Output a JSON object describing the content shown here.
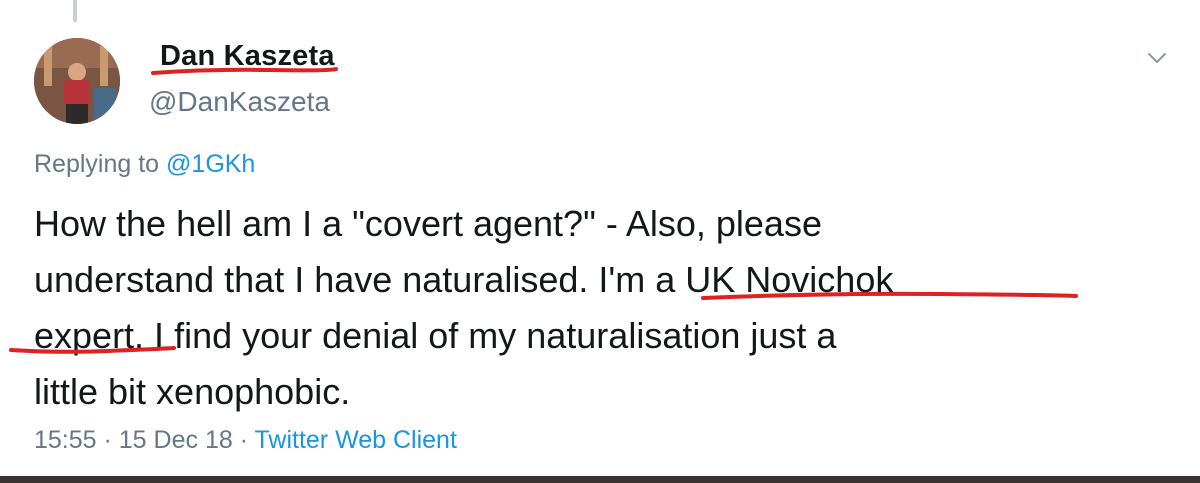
{
  "tweet": {
    "display_name": "Dan Kaszeta",
    "handle": "@DanKaszeta",
    "replying_prefix": "Replying to ",
    "replying_to": "@1GKh",
    "text_lines": [
      "How the hell am I a \"covert agent?\" - Also, please",
      "understand that I have naturalised. I'm a UK Novichok",
      "expert. I find your denial of my naturalisation just a",
      "little bit xenophobic."
    ],
    "time": "15:55",
    "separator": " · ",
    "date": "15 Dec 18",
    "client": "Twitter Web Client"
  },
  "icons": {
    "menu": "chevron-down-icon",
    "avatar": "profile-photo"
  },
  "colors": {
    "text": "#14171a",
    "secondary": "#657786",
    "link": "#1b95e0",
    "annotation": "#e0211f"
  }
}
